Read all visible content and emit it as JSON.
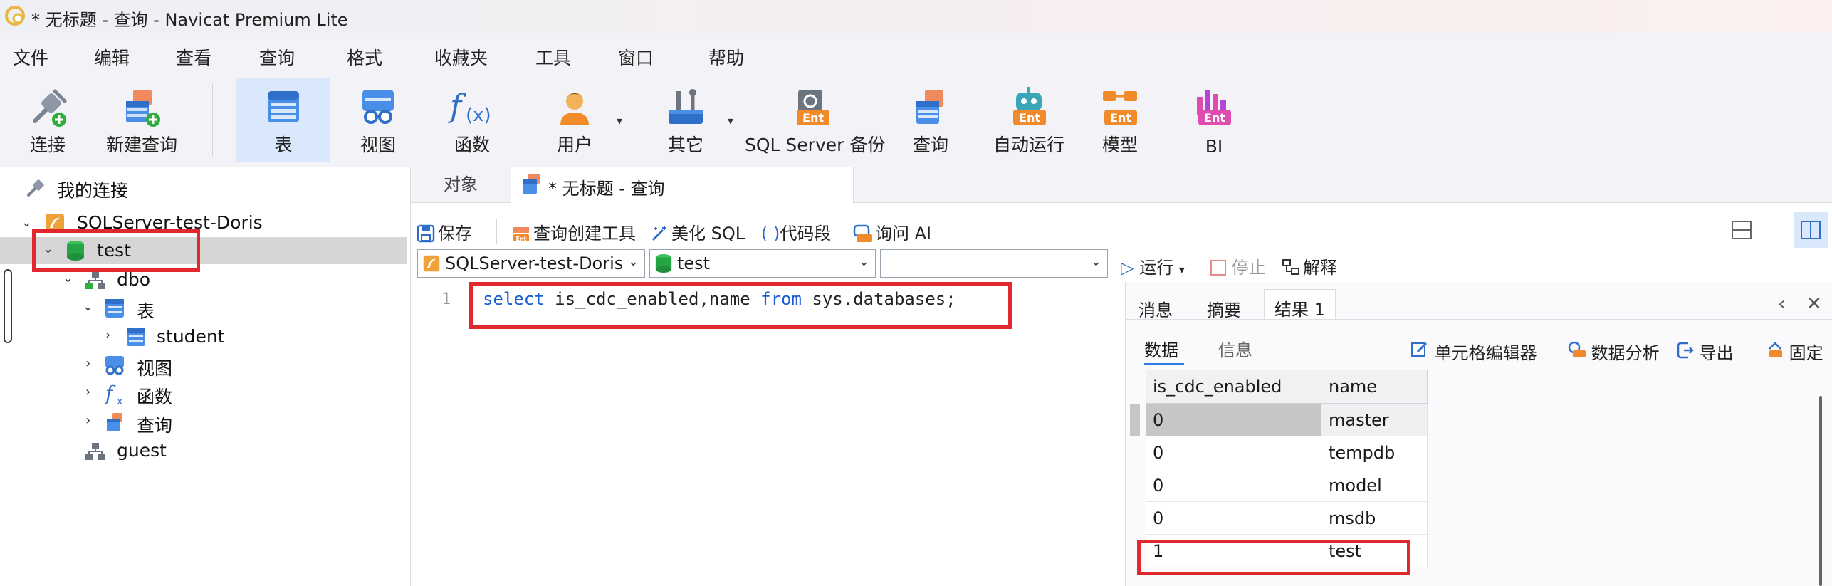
{
  "window": {
    "title": "* 无标题 - 查询 - Navicat Premium Lite"
  },
  "menu": [
    "文件",
    "编辑",
    "查看",
    "查询",
    "格式",
    "收藏夹",
    "工具",
    "窗口",
    "帮助"
  ],
  "toolbar": {
    "connect": "连接",
    "new_query": "新建查询",
    "table": "表",
    "view": "视图",
    "function": "函数",
    "user": "用户",
    "other": "其它",
    "backup": "SQL Server 备份",
    "query": "查询",
    "automation": "自动运行",
    "model": "模型",
    "bi": "BI",
    "ent_badge": "Ent"
  },
  "tree": {
    "my_connections": "我的连接",
    "connection": "SQLServer-test-Doris",
    "database": "test",
    "schema": "dbo",
    "tables": "表",
    "student": "student",
    "views": "视图",
    "functions": "函数",
    "queries": "查询",
    "guest": "guest"
  },
  "tabs": {
    "objects": "对象",
    "query": "* 无标题 - 查询"
  },
  "editor_toolbar": {
    "save": "保存",
    "query_builder": "查询创建工具",
    "beautify": "美化 SQL",
    "snippet": "代码段",
    "ask_ai": "询问 AI",
    "run": "运行",
    "stop": "停止",
    "explain": "解释"
  },
  "selectors": {
    "connection": "SQLServer-test-Doris",
    "database": "test",
    "schema": ""
  },
  "editor": {
    "line_number": "1",
    "kw_select": "select",
    "mid": " is_cdc_enabled,name ",
    "kw_from": "from",
    "tail": " sys.databases;"
  },
  "results": {
    "tabs": [
      "消息",
      "摘要",
      "结果 1"
    ],
    "subtabs": [
      "数据",
      "信息"
    ],
    "actions": {
      "cell_editor": "单元格编辑器",
      "data_analysis": "数据分析",
      "export": "导出",
      "pin": "固定"
    },
    "columns": [
      "is_cdc_enabled",
      "name"
    ],
    "rows": [
      [
        "0",
        "master"
      ],
      [
        "0",
        "tempdb"
      ],
      [
        "0",
        "model"
      ],
      [
        "0",
        "msdb"
      ],
      [
        "1",
        "test"
      ]
    ]
  },
  "colors": {
    "highlight_red": "#e0282e",
    "keyword_blue": "#1a5fd1",
    "active_tab": "#d9e8fb"
  }
}
